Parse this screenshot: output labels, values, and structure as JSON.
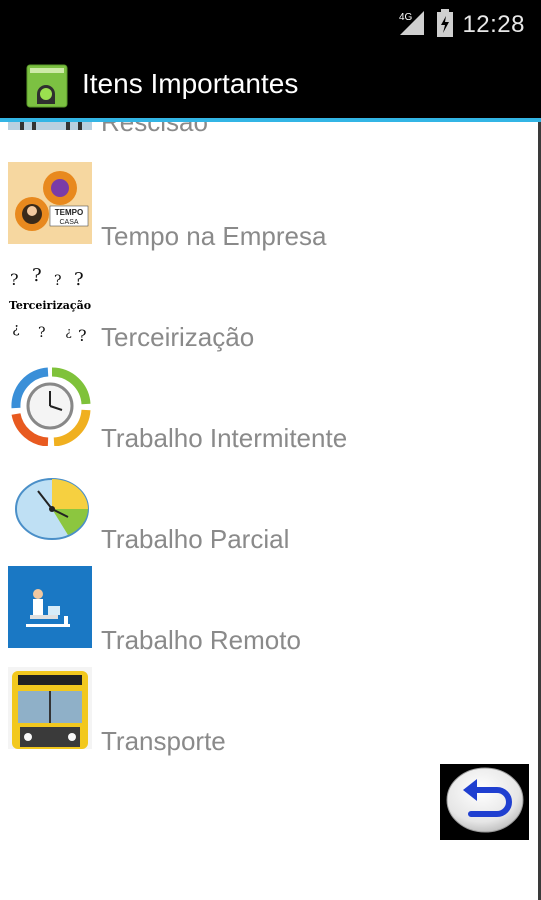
{
  "status_bar": {
    "time": "12:28",
    "network": "4G"
  },
  "app": {
    "title": "Itens Importantes"
  },
  "list": {
    "items": [
      {
        "label": "Rescisão",
        "icon": "rescisao-thumbnail"
      },
      {
        "label": "Tempo na Empresa",
        "icon": "tempo-casa-thumbnail",
        "thumb_text_1": "TEMPO",
        "thumb_text_2": "CASA"
      },
      {
        "label": "Terceirização",
        "icon": "terceirizacao-thumbnail",
        "thumb_text": "Terceirização"
      },
      {
        "label": "Trabalho Intermitente",
        "icon": "clock-cycle-thumbnail"
      },
      {
        "label": "Trabalho Parcial",
        "icon": "partial-clock-thumbnail"
      },
      {
        "label": "Trabalho Remoto",
        "icon": "remote-work-thumbnail"
      },
      {
        "label": "Transporte",
        "icon": "bus-thumbnail"
      }
    ]
  },
  "back_button": {
    "icon": "back-arrow-icon"
  },
  "colors": {
    "accent": "#33b5e5",
    "label_text": "#8a8a8a",
    "action_bar": "#000000"
  }
}
